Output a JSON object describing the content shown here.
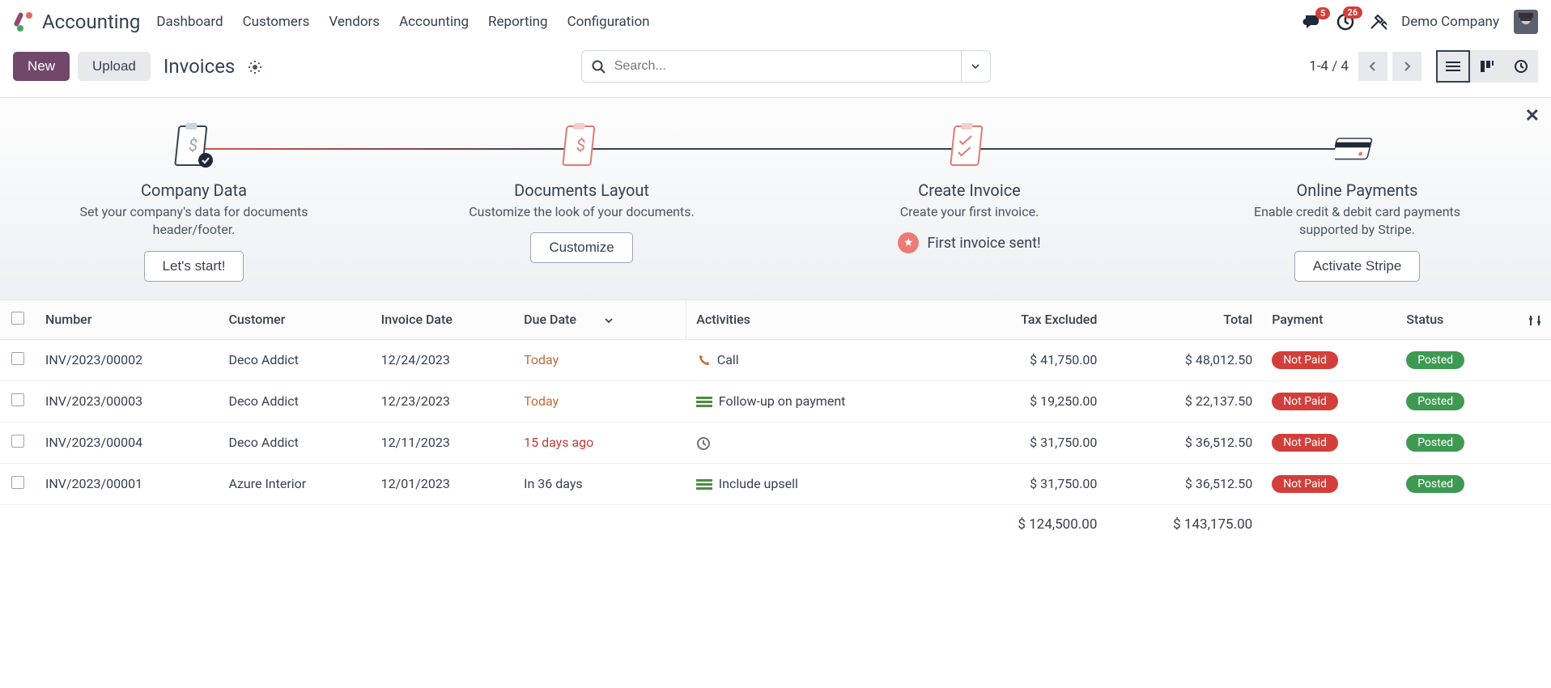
{
  "app": {
    "name": "Accounting"
  },
  "nav": {
    "items": [
      "Dashboard",
      "Customers",
      "Vendors",
      "Accounting",
      "Reporting",
      "Configuration"
    ]
  },
  "header": {
    "messages_badge": "5",
    "activities_badge": "26",
    "company": "Demo Company"
  },
  "controls": {
    "new_label": "New",
    "upload_label": "Upload",
    "breadcrumb": "Invoices",
    "search_placeholder": "Search...",
    "pager": "1-4 / 4"
  },
  "onboarding": {
    "steps": [
      {
        "title": "Company Data",
        "desc": "Set your company's data for documents header/footer.",
        "action_label": "Let's start!",
        "action_type": "button"
      },
      {
        "title": "Documents Layout",
        "desc": "Customize the look of your documents.",
        "action_label": "Customize",
        "action_type": "button"
      },
      {
        "title": "Create Invoice",
        "desc": "Create your first invoice.",
        "action_label": "First invoice sent!",
        "action_type": "done"
      },
      {
        "title": "Online Payments",
        "desc": "Enable credit & debit card payments supported by Stripe.",
        "action_label": "Activate Stripe",
        "action_type": "button"
      }
    ]
  },
  "table": {
    "columns": {
      "number": "Number",
      "customer": "Customer",
      "invoice_date": "Invoice Date",
      "due_date": "Due Date",
      "activities": "Activities",
      "tax_excluded": "Tax Excluded",
      "total": "Total",
      "payment": "Payment",
      "status": "Status"
    },
    "rows": [
      {
        "number": "INV/2023/00002",
        "customer": "Deco Addict",
        "invoice_date": "12/24/2023",
        "due_date": "Today",
        "due_class": "due-today",
        "activity_icon": "call",
        "activity_label": "Call",
        "tax_excluded": "$ 41,750.00",
        "total": "$ 48,012.50",
        "payment": "Not Paid",
        "status": "Posted"
      },
      {
        "number": "INV/2023/00003",
        "customer": "Deco Addict",
        "invoice_date": "12/23/2023",
        "due_date": "Today",
        "due_class": "due-today",
        "activity_icon": "task",
        "activity_label": "Follow-up on payment",
        "tax_excluded": "$ 19,250.00",
        "total": "$ 22,137.50",
        "payment": "Not Paid",
        "status": "Posted"
      },
      {
        "number": "INV/2023/00004",
        "customer": "Deco Addict",
        "invoice_date": "12/11/2023",
        "due_date": "15 days ago",
        "due_class": "due-late",
        "activity_icon": "clock",
        "activity_label": "",
        "tax_excluded": "$ 31,750.00",
        "total": "$ 36,512.50",
        "payment": "Not Paid",
        "status": "Posted"
      },
      {
        "number": "INV/2023/00001",
        "customer": "Azure Interior",
        "invoice_date": "12/01/2023",
        "due_date": "In 36 days",
        "due_class": "",
        "activity_icon": "task",
        "activity_label": "Include upsell",
        "tax_excluded": "$ 31,750.00",
        "total": "$ 36,512.50",
        "payment": "Not Paid",
        "status": "Posted"
      }
    ],
    "totals": {
      "tax_excluded": "$ 124,500.00",
      "total": "$ 143,175.00"
    }
  }
}
